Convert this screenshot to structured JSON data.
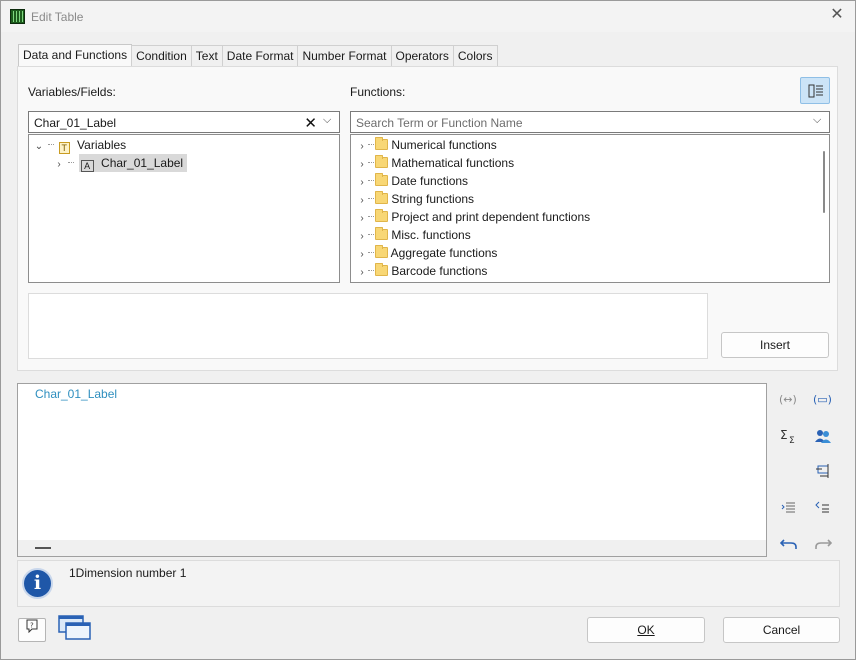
{
  "window": {
    "title": "Edit Table"
  },
  "tabs": [
    {
      "label": "Data and Functions"
    },
    {
      "label": "Condition"
    },
    {
      "label": "Text"
    },
    {
      "label": "Date Format"
    },
    {
      "label": "Number Format"
    },
    {
      "label": "Operators"
    },
    {
      "label": "Colors"
    }
  ],
  "variables": {
    "label": "Variables/Fields:",
    "search_value": "Char_01_Label",
    "tree": {
      "root": "Variables",
      "child": "Char_01_Label"
    }
  },
  "functions": {
    "label": "Functions:",
    "search_placeholder": "Search Term or Function Name",
    "items": [
      {
        "label": "Numerical functions"
      },
      {
        "label": "Mathematical functions"
      },
      {
        "label": "Date functions"
      },
      {
        "label": "String functions"
      },
      {
        "label": "Project and print dependent functions"
      },
      {
        "label": "Misc. functions"
      },
      {
        "label": "Aggregate functions"
      },
      {
        "label": "Barcode functions"
      }
    ]
  },
  "insert_label": "Insert",
  "editor": {
    "expression": "Char_01_Label"
  },
  "info": {
    "message": "1Dimension number 1"
  },
  "footer": {
    "ok_label": "OK",
    "cancel_label": "Cancel"
  },
  "colors": {
    "accent": "#2f8fbf",
    "info_blue": "#1f57a8",
    "selected_toggle": "#cce4f7"
  }
}
